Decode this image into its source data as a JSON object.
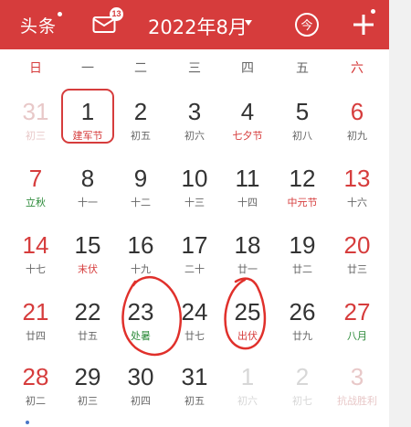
{
  "header": {
    "toutiao_label": "头条",
    "mail_badge": "13",
    "month_title": "2022年8月",
    "today_icon": "今",
    "plus_label": "+"
  },
  "weekdays": [
    "日",
    "一",
    "二",
    "三",
    "四",
    "五",
    "六"
  ],
  "weeks": [
    [
      {
        "day": "31",
        "sub": "初三",
        "style": "faded"
      },
      {
        "day": "1",
        "sub": "建军节",
        "style": "today"
      },
      {
        "day": "2",
        "sub": "初五",
        "style": ""
      },
      {
        "day": "3",
        "sub": "初六",
        "style": ""
      },
      {
        "day": "4",
        "sub": "七夕节",
        "style": "festival"
      },
      {
        "day": "5",
        "sub": "初八",
        "style": ""
      },
      {
        "day": "6",
        "sub": "初九",
        "style": "weekend"
      }
    ],
    [
      {
        "day": "7",
        "sub": "立秋",
        "style": "solar"
      },
      {
        "day": "8",
        "sub": "十一",
        "style": ""
      },
      {
        "day": "9",
        "sub": "十二",
        "style": ""
      },
      {
        "day": "10",
        "sub": "十三",
        "style": ""
      },
      {
        "day": "11",
        "sub": "十四",
        "style": ""
      },
      {
        "day": "12",
        "sub": "中元节",
        "style": "festival"
      },
      {
        "day": "13",
        "sub": "十六",
        "style": "weekend"
      }
    ],
    [
      {
        "day": "14",
        "sub": "十七",
        "style": "weekend"
      },
      {
        "day": "15",
        "sub": "末伏",
        "style": "festival"
      },
      {
        "day": "16",
        "sub": "十九",
        "style": ""
      },
      {
        "day": "17",
        "sub": "二十",
        "style": ""
      },
      {
        "day": "18",
        "sub": "廿一",
        "style": ""
      },
      {
        "day": "19",
        "sub": "廿二",
        "style": ""
      },
      {
        "day": "20",
        "sub": "廿三",
        "style": "weekend"
      }
    ],
    [
      {
        "day": "21",
        "sub": "廿四",
        "style": "weekend"
      },
      {
        "day": "22",
        "sub": "廿五",
        "style": ""
      },
      {
        "day": "23",
        "sub": "处暑",
        "style": "solar"
      },
      {
        "day": "24",
        "sub": "廿七",
        "style": ""
      },
      {
        "day": "25",
        "sub": "出伏",
        "style": "festival"
      },
      {
        "day": "26",
        "sub": "廿九",
        "style": ""
      },
      {
        "day": "27",
        "sub": "八月",
        "style": "weekend-green"
      }
    ],
    [
      {
        "day": "28",
        "sub": "初二",
        "style": "weekend"
      },
      {
        "day": "29",
        "sub": "初三",
        "style": ""
      },
      {
        "day": "30",
        "sub": "初四",
        "style": ""
      },
      {
        "day": "31",
        "sub": "初五",
        "style": ""
      },
      {
        "day": "1",
        "sub": "初六",
        "style": "faded-gray"
      },
      {
        "day": "2",
        "sub": "初七",
        "style": "faded-gray"
      },
      {
        "day": "3",
        "sub": "抗战胜利",
        "style": "faded"
      }
    ]
  ],
  "colors": {
    "header_red": "#d63c3c",
    "holiday_red": "#d63c3c",
    "solar_green": "#2e8b3b"
  }
}
